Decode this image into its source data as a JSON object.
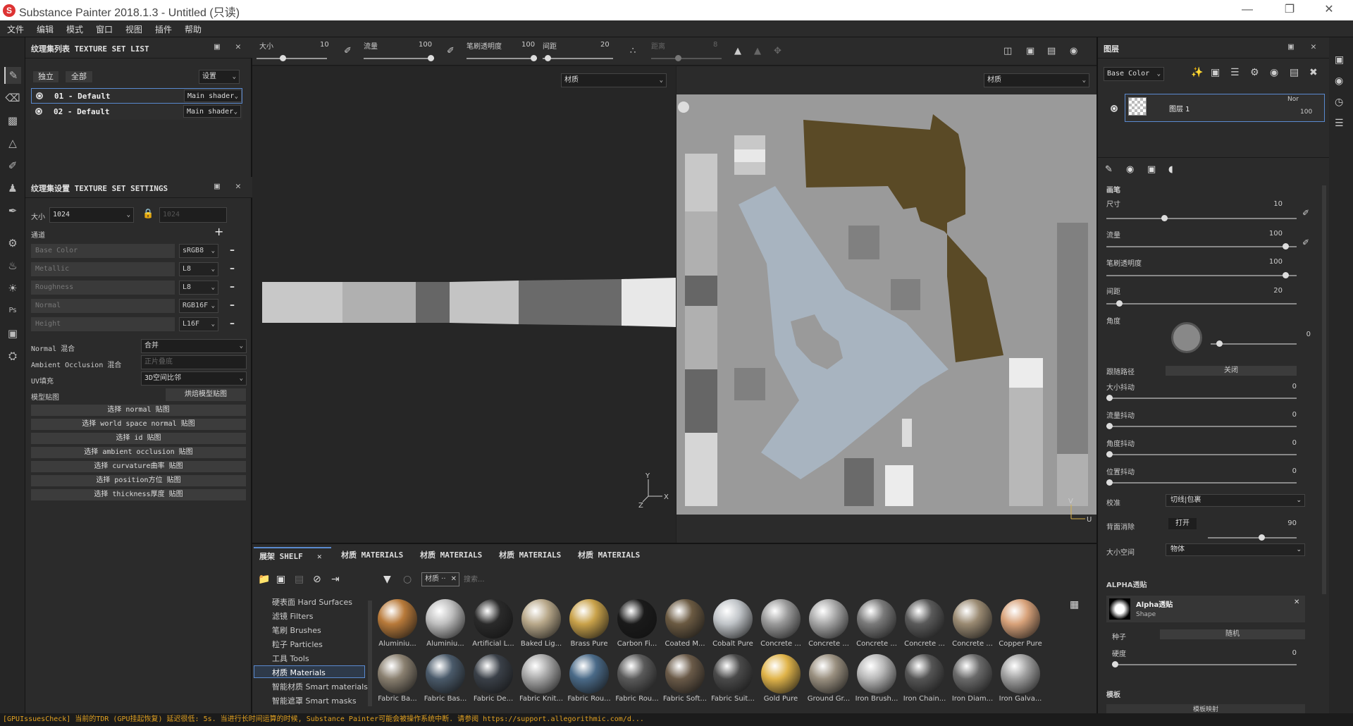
{
  "window": {
    "title": "Substance Painter 2018.1.3 - Untitled (只读)"
  },
  "menu": [
    "文件",
    "编辑",
    "模式",
    "窗口",
    "视图",
    "插件",
    "帮助"
  ],
  "texture_set_list": {
    "title": "纹理集列表 TEXTURE SET LIST",
    "btn_solo": "独立",
    "btn_all": "全部",
    "settings": "设置",
    "items": [
      {
        "name": "01 - Default",
        "shader": "Main shader"
      },
      {
        "name": "02 - Default",
        "shader": "Main shader"
      }
    ]
  },
  "texture_set_settings": {
    "title": "纹理集设置 TEXTURE SET SETTINGS",
    "size_label": "大小",
    "size_value": "1024",
    "size_locked_value": "1024",
    "channels_label": "通道",
    "channels": [
      {
        "name": "Base Color",
        "format": "sRGB8"
      },
      {
        "name": "Metallic",
        "format": "L8"
      },
      {
        "name": "Roughness",
        "format": "L8"
      },
      {
        "name": "Normal",
        "format": "RGB16F"
      },
      {
        "name": "Height",
        "format": "L16F"
      }
    ],
    "normal_mix_label": "Normal 混合",
    "normal_mix_value": "合并",
    "ao_mix_label": "Ambient Occlusion 混合",
    "ao_mix_value": "正片叠底",
    "uv_label": "UV填充",
    "uv_value": "3D空间比邻",
    "mesh_maps_label": "模型贴图",
    "bake_btn": "烘焙模型贴图",
    "map_buttons": [
      "选择 normal 贴图",
      "选择 world space normal 贴图",
      "选择 id 贴图",
      "选择 ambient occlusion 贴图",
      "选择 curvature曲率 贴图",
      "选择 position方位 贴图",
      "选择 thickness厚度 贴图"
    ]
  },
  "toolbar": {
    "size_label": "大小",
    "size_value": "10",
    "flow_label": "流量",
    "flow_value": "100",
    "opacity_label": "笔刷透明度",
    "opacity_value": "100",
    "spacing_label": "间距",
    "spacing_value": "20",
    "distance_label": "距离",
    "distance_value": "8",
    "progress": {
      "size": 0.2,
      "flow": 1.0,
      "opacity": 1.0,
      "spacing": 0.2
    }
  },
  "viewport": {
    "view3d_select": "材质",
    "view2d_select": "材质"
  },
  "layers": {
    "title": "图层",
    "channel_select": "Base Color",
    "layer_name": "图层 1",
    "blend": "Nor",
    "opacity": "100"
  },
  "brush_props": {
    "section": "画笔",
    "size_label": "尺寸",
    "size_value": "10",
    "flow_label": "流量",
    "flow_value": "100",
    "opacity_label": "笔刷透明度",
    "opacity_value": "100",
    "spacing_label": "间距",
    "spacing_value": "20",
    "angle_label": "角度",
    "angle_value": "0",
    "follow_path_label": "跟随路径",
    "follow_path_value": "关闭",
    "size_jitter_label": "大小抖动",
    "size_jitter_value": "0",
    "flow_jitter_label": "流量抖动",
    "flow_jitter_value": "0",
    "angle_jitter_label": "角度抖动",
    "angle_jitter_value": "0",
    "pos_jitter_label": "位置抖动",
    "pos_jitter_value": "0",
    "align_label": "校准",
    "align_value": "切线|包裹",
    "backface_label": "背面消除",
    "backface_btn": "打开",
    "backface_value": "90",
    "size_space_label": "大小空间",
    "size_space_value": "物体",
    "alpha_section": "ALPHA透贴",
    "alpha_name": "Alpha透贴",
    "alpha_type": "Shape",
    "seed_label": "种子",
    "seed_value": "随机",
    "hardness_label": "硬度",
    "hardness_value": "0",
    "stencil_section": "模板",
    "stencil_btn": "模板映射"
  },
  "shelf": {
    "tabs": [
      "展架 SHELF",
      "材质 MATERIALS",
      "材质 MATERIALS",
      "材质 MATERIALS",
      "材质 MATERIALS"
    ],
    "filter_tag": "材质 ··",
    "search_placeholder": "搜索...",
    "categories": [
      "硬表面 Hard Surfaces",
      "滤镜 Filters",
      "笔刷 Brushes",
      "粒子 Particles",
      "工具 Tools",
      "材质 Materials",
      "智能材质 Smart materials",
      "智能遮罩 Smart masks"
    ],
    "materials_row1": [
      "Aluminiu...",
      "Aluminiu...",
      "Artificial L...",
      "Baked Lig...",
      "Brass Pure",
      "Carbon Fi...",
      "Coated M...",
      "Cobalt Pure",
      "Concrete ...",
      "Concrete ...",
      "Concrete ...",
      "Concrete ...",
      "Concrete ...",
      "Copper Pure"
    ],
    "materials_row2": [
      "Fabric Ba...",
      "Fabric Bas...",
      "Fabric De...",
      "Fabric Knit...",
      "Fabric Rou...",
      "Fabric Rou...",
      "Fabric Soft...",
      "Fabric Suit...",
      "Gold Pure",
      "Ground Gr...",
      "Iron Brush...",
      "Iron Chain...",
      "Iron Diam...",
      "Iron Galva..."
    ],
    "colors_row1": [
      "#b87a3a",
      "#bfbfbf",
      "#2a2a2a",
      "#b8a88a",
      "#c9a24a",
      "#1a1a1a",
      "#6b5a42",
      "#c0c4c8",
      "#9a9a9a",
      "#a8a8a8",
      "#7a7a7a",
      "#5a5a5a",
      "#9a8a72",
      "#d8a27a"
    ],
    "colors_row2": [
      "#8a8070",
      "#4a5a6a",
      "#3a4048",
      "#a8a8a8",
      "#4a6a88",
      "#5a5a5a",
      "#6a5a48",
      "#4a4a4a",
      "#e0b44a",
      "#9a9080",
      "#b8b8b8",
      "#555555",
      "#6a6a6a",
      "#a0a0a0"
    ]
  },
  "status": "[GPUIssuesCheck] 当前的TDR (GPU挂起恢复) 延迟很低: 5s. 当进行长时间运算的时候, Substance Painter可能会被操作系统中断. 请参阅 https://support.allegorithmic.com/d..."
}
